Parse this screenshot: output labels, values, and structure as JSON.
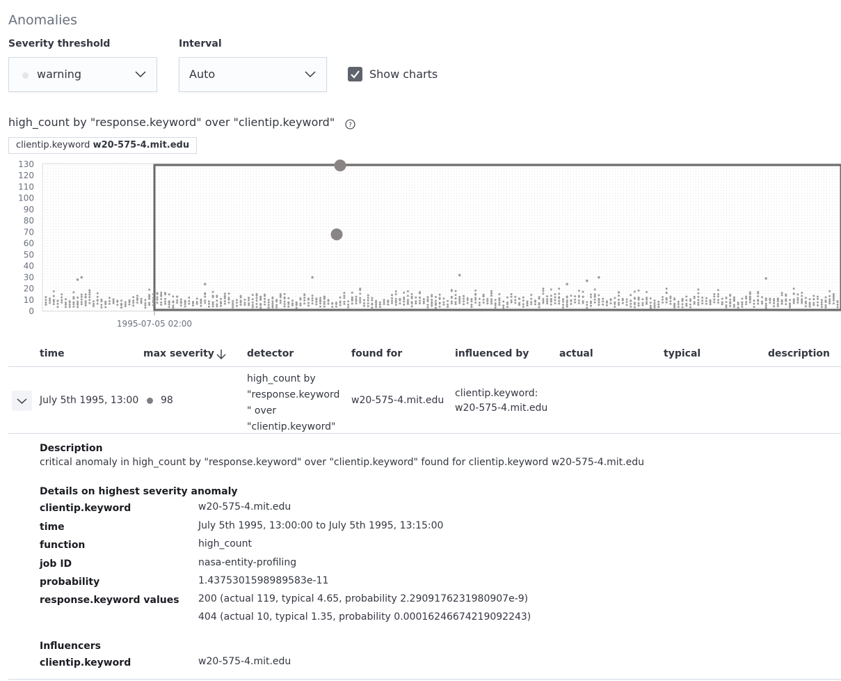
{
  "page_title": "Anomalies",
  "controls": {
    "severity_label": "Severity threshold",
    "severity_value": "warning",
    "interval_label": "Interval",
    "interval_value": "Auto",
    "show_charts_label": "Show charts",
    "show_charts_checked": true
  },
  "chart": {
    "title": "high_count by \"response.keyword\" over \"clientip.keyword\"",
    "entity_field": "clientip.keyword",
    "entity_value": "w20-575-4.mit.edu",
    "x_tick_label": "1995-07-05 02:00"
  },
  "chart_data": {
    "type": "scatter",
    "title": "high_count by \"response.keyword\" over \"clientip.keyword\"",
    "xlabel": "",
    "ylabel": "",
    "ylim": [
      0,
      130
    ],
    "y_ticks": [
      0,
      10,
      20,
      30,
      40,
      50,
      60,
      70,
      80,
      90,
      100,
      110,
      120,
      130
    ],
    "x_ticks": [
      "1995-07-05 02:00"
    ],
    "anomaly_points": [
      {
        "label": "anomaly-high",
        "y": 129
      },
      {
        "label": "anomaly-mid",
        "y": 68
      }
    ],
    "outlier_points": [
      {
        "bucket": 8,
        "y": 28
      },
      {
        "bucket": 9,
        "y": 30
      },
      {
        "bucket": 40,
        "y": 24
      },
      {
        "bucket": 67,
        "y": 30
      },
      {
        "bucket": 104,
        "y": 32
      },
      {
        "bucket": 131,
        "y": 24
      },
      {
        "bucket": 136,
        "y": 27
      },
      {
        "bucket": 139,
        "y": 30
      },
      {
        "bucket": 181,
        "y": 29
      }
    ],
    "baseline_range": [
      0,
      20
    ]
  },
  "table": {
    "headers": [
      "time",
      "max severity",
      "detector",
      "found for",
      "influenced by",
      "actual",
      "typical",
      "description"
    ],
    "row": {
      "time": "July 5th 1995, 13:00",
      "severity": "98",
      "detector_lines": [
        "high_count by",
        "\"response.keyword",
        "\" over",
        "\"clientip.keyword\""
      ],
      "found_for": "w20-575-4.mit.edu",
      "influenced_lines": [
        "clientip.keyword:",
        "w20-575-4.mit.edu"
      ]
    }
  },
  "details": {
    "description_heading": "Description",
    "description_text": "critical anomaly in high_count by \"response.keyword\" over \"clientip.keyword\" found for clientip.keyword w20-575-4.mit.edu",
    "highest_heading": "Details on highest severity anomaly",
    "rows": [
      {
        "key": "clientip.keyword",
        "value": "w20-575-4.mit.edu"
      },
      {
        "key": "time",
        "value": "July 5th 1995, 13:00:00 to July 5th 1995, 13:15:00"
      },
      {
        "key": "function",
        "value": "high_count"
      },
      {
        "key": "job ID",
        "value": "nasa-entity-profiling"
      },
      {
        "key": "probability",
        "value": "1.4375301598989583e-11"
      },
      {
        "key": "response.keyword values",
        "value": "200 (actual 119, typical 4.65, probability 2.2909176231980907e-9)"
      }
    ],
    "extra_value": "404 (actual 10, typical 1.35, probability 0.00016246674219092243)",
    "influencers_heading": "Influencers",
    "influencer": {
      "key": "clientip.keyword",
      "value": "w20-575-4.mit.edu"
    }
  },
  "colors": {
    "point": "#9c9c9c",
    "anomaly": "#8a8584",
    "frame": "#6a6a6a"
  }
}
